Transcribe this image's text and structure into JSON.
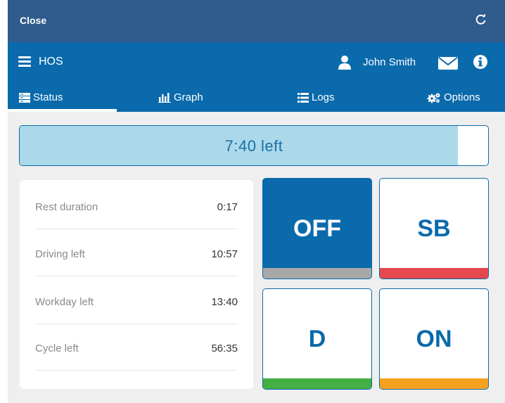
{
  "window": {
    "close_label": "Close",
    "refresh_icon": "refresh-icon"
  },
  "appbar": {
    "title": "HOS",
    "user_name": "John Smith"
  },
  "tabs": [
    {
      "label": "Status",
      "icon": "status-list-icon",
      "selected": true
    },
    {
      "label": "Graph",
      "icon": "bar-chart-icon",
      "selected": false
    },
    {
      "label": "Logs",
      "icon": "list-icon",
      "selected": false
    },
    {
      "label": "Options",
      "icon": "gears-icon",
      "selected": false
    }
  ],
  "timer": {
    "label": "7:40 left",
    "fraction_elapsed": 0.935
  },
  "summary": {
    "rows": [
      {
        "label": "Rest duration",
        "value": "0:17"
      },
      {
        "label": "Driving left",
        "value": "10:57"
      },
      {
        "label": "Workday left",
        "value": "13:40"
      },
      {
        "label": "Cycle left",
        "value": "56:35"
      }
    ]
  },
  "duty_status": {
    "buttons": [
      {
        "code": "OFF",
        "color": "#a8a8a8",
        "active": true
      },
      {
        "code": "SB",
        "color": "#e5484d",
        "active": false
      },
      {
        "code": "D",
        "color": "#44b044",
        "active": false
      },
      {
        "code": "ON",
        "color": "#f4a21d",
        "active": false
      }
    ]
  },
  "colors": {
    "header": "#2f5b8d",
    "primary": "#0a6aab",
    "progress_fill": "#abd9e9",
    "background": "#efefef"
  }
}
